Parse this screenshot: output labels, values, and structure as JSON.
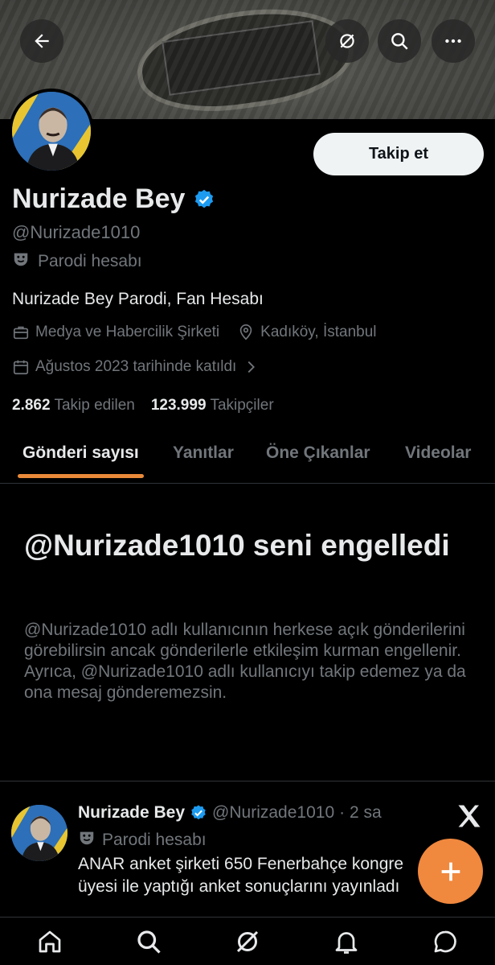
{
  "header": {
    "back_icon": "arrow-left-icon",
    "grok_icon": "grok-icon",
    "search_icon": "search-icon",
    "more_icon": "more-icon"
  },
  "profile": {
    "follow_label": "Takip et",
    "name": "Nurizade Bey",
    "handle": "@Nurizade1010",
    "parody_label": "Parodi hesabı",
    "bio": "Nurizade Bey Parodi, Fan Hesabı",
    "category": "Medya ve Habercilik Şirketi",
    "location": "Kadıköy, İstanbul",
    "joined": "Ağustos 2023 tarihinde katıldı",
    "following_count": "2.862",
    "following_label": "Takip edilen",
    "followers_count": "123.999",
    "followers_label": "Takipçiler"
  },
  "tabs": [
    {
      "label": "Gönderi sayısı",
      "active": true
    },
    {
      "label": "Yanıtlar",
      "active": false
    },
    {
      "label": "Öne Çıkanlar",
      "active": false
    },
    {
      "label": "Videolar",
      "active": false
    }
  ],
  "blocked": {
    "title": "@Nurizade1010 seni engelledi",
    "description": "@Nurizade1010 adlı kullanıcının herkese açık gönderilerini görebilirsin ancak gönderilerle etkileşim kurman engellenir. Ayrıca, @Nurizade1010 adlı kullanıcıyı takip edemez ya da ona mesaj gönderemezsin."
  },
  "post": {
    "name": "Nurizade Bey",
    "handle": "@Nurizade1010",
    "time": "· 2 sa",
    "parody_label": "Parodi hesabı",
    "line1": "ANAR anket şirketi 650 Fenerbahçe kongre",
    "line2": "üyesi ile yaptığı anket sonuçlarını yayınladı"
  },
  "colors": {
    "accent": "#f0883e",
    "verified": "#1d9bf0",
    "muted": "#71767b"
  }
}
